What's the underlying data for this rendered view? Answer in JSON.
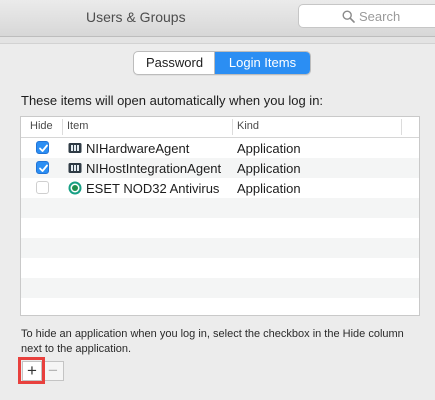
{
  "window": {
    "title": "Users & Groups"
  },
  "search": {
    "placeholder": "Search"
  },
  "tabs": [
    {
      "label": "Password",
      "selected": false
    },
    {
      "label": "Login Items",
      "selected": true
    }
  ],
  "intro_text": "These items will open automatically when you log in:",
  "table": {
    "columns": [
      "Hide",
      "Item",
      "Kind"
    ],
    "rows": [
      {
        "hide": true,
        "icon": "ni-app-icon",
        "name": "NIHardwareAgent",
        "kind": "Application"
      },
      {
        "hide": true,
        "icon": "ni-app-icon",
        "name": "NIHostIntegrationAgent",
        "kind": "Application"
      },
      {
        "hide": false,
        "icon": "eset-app-icon",
        "name": "ESET NOD32 Antivirus",
        "kind": "Application"
      }
    ]
  },
  "footnote": "To hide an application when you log in, select the checkbox in the Hide column next to the application.",
  "buttons": {
    "add": "+",
    "remove": "−"
  },
  "colors": {
    "accent": "#2b8ef3",
    "highlight": "#e8403d"
  }
}
